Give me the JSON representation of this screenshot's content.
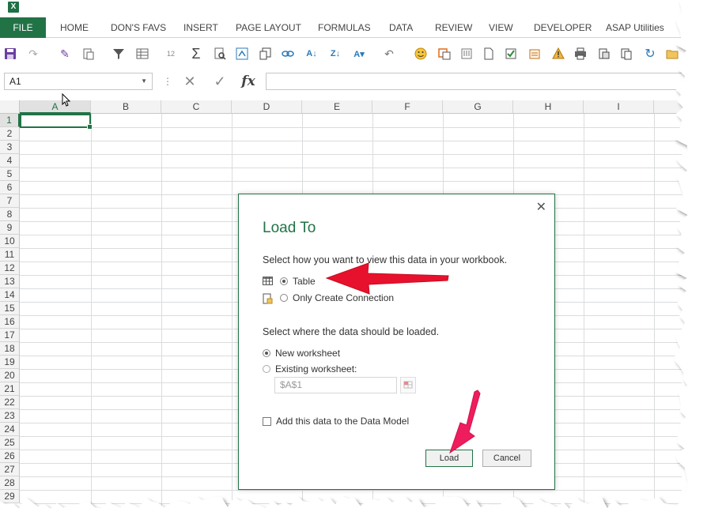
{
  "ribbon": {
    "file_tab": "FILE",
    "tabs": [
      "HOME",
      "DON'S FAVS",
      "INSERT",
      "PAGE LAYOUT",
      "FORMULAS",
      "DATA",
      "REVIEW",
      "VIEW",
      "DEVELOPER",
      "ASAP Utilities"
    ]
  },
  "toolbar": {
    "icons": [
      "save-icon",
      "redo-icon",
      "format-painter-icon",
      "paste-special-icon",
      "filter-icon",
      "table-format-icon",
      "number-format-icon",
      "autosum-icon",
      "find-icon",
      "insert-function-icon",
      "copy-icon",
      "link-icon",
      "sort-ascending-icon",
      "sort-descending-icon",
      "sort-icon",
      "undo-icon",
      "smiley-icon",
      "screenshot-icon",
      "attach-icon",
      "new-document-icon",
      "check-icon",
      "notes-icon",
      "warning-icon",
      "print-icon",
      "print-preview-icon",
      "copy-sheet-icon",
      "refresh-icon",
      "folder-icon"
    ],
    "font_size_badge": "12"
  },
  "formula_bar": {
    "name_box": "A1",
    "cancel_symbol": "✕",
    "enter_symbol": "✓",
    "fx_symbol": "fx",
    "formula_value": ""
  },
  "sheet": {
    "columns": [
      "A",
      "B",
      "C",
      "D",
      "E",
      "F",
      "G",
      "H",
      "I"
    ],
    "rows": [
      "1",
      "2",
      "3",
      "4",
      "5",
      "6",
      "7",
      "8",
      "9",
      "10",
      "11",
      "12",
      "13",
      "14",
      "15",
      "16",
      "17",
      "18",
      "19",
      "20",
      "21",
      "22",
      "23",
      "24",
      "25",
      "26",
      "27",
      "28",
      "29"
    ],
    "active_cell": "A1"
  },
  "dialog": {
    "title": "Load To",
    "close_symbol": "✕",
    "view_prompt": "Select how you want to view this data in your workbook.",
    "view_options": [
      {
        "label": "Table",
        "checked": true
      },
      {
        "label": "Only Create Connection",
        "checked": false
      }
    ],
    "location_prompt": "Select where the data should be loaded.",
    "location_options": [
      {
        "label": "New worksheet",
        "checked": true
      },
      {
        "label": "Existing worksheet:",
        "checked": false
      }
    ],
    "cell_reference": "$A$1",
    "data_model_label": "Add this data to the Data Model",
    "data_model_checked": false,
    "load_button": "Load",
    "cancel_button": "Cancel"
  },
  "annotations": {
    "arrow_color": "#e8112d",
    "secondary_arrow_color": "#ef1d5d"
  },
  "colors": {
    "excel_green": "#217346",
    "file_tab_bg": "#217346"
  }
}
